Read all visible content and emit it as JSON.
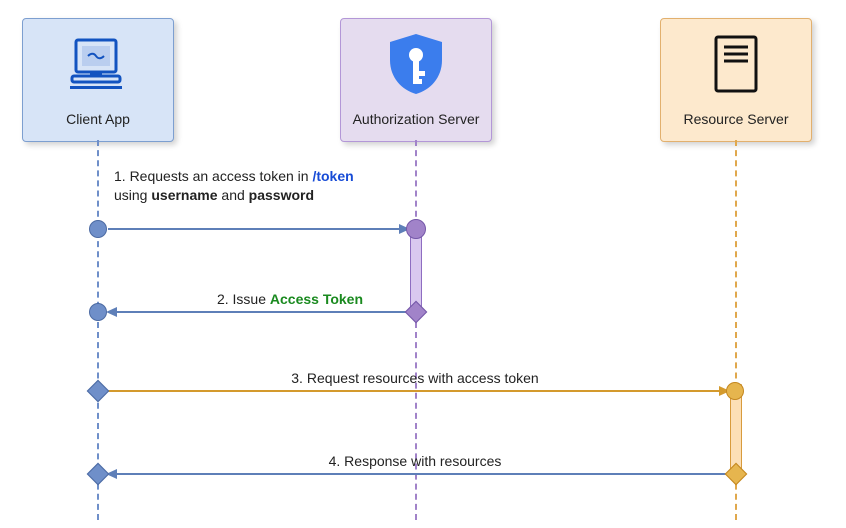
{
  "actors": {
    "client": {
      "label": "Client App"
    },
    "auth": {
      "label": "Authorization Server"
    },
    "resource": {
      "label": "Resource Server"
    }
  },
  "messages": {
    "m1": {
      "pre": "1. Requests an access token in ",
      "path": "/token",
      "mid1": " using ",
      "kw1": "username",
      "mid2": " and ",
      "kw2": "password"
    },
    "m2": {
      "pre": "2. Issue ",
      "token": "Access Token"
    },
    "m3": {
      "text": "3. Request resources with access token"
    },
    "m4": {
      "text": "4. Response with resources"
    }
  }
}
